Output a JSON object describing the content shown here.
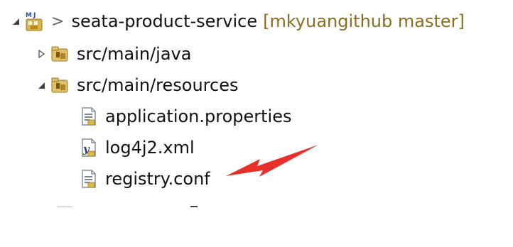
{
  "tree": {
    "project": {
      "git_marker": ">",
      "label": "seata-product-service",
      "git_info": "[mkyuangithub master]",
      "expanded": true,
      "icon": "maven-java-project-icon"
    },
    "items": [
      {
        "label": "src/main/java",
        "expanded": false,
        "icon": "source-folder-icon"
      },
      {
        "label": "src/main/resources",
        "expanded": true,
        "icon": "source-folder-icon"
      },
      {
        "label": "application.properties",
        "icon": "properties-file-icon"
      },
      {
        "label": "log4j2.xml",
        "icon": "xml-file-icon"
      },
      {
        "label": "registry.conf",
        "icon": "text-file-icon"
      }
    ]
  },
  "annotation": {
    "arrow_color": "#e8302a",
    "points_to": "registry.conf"
  }
}
